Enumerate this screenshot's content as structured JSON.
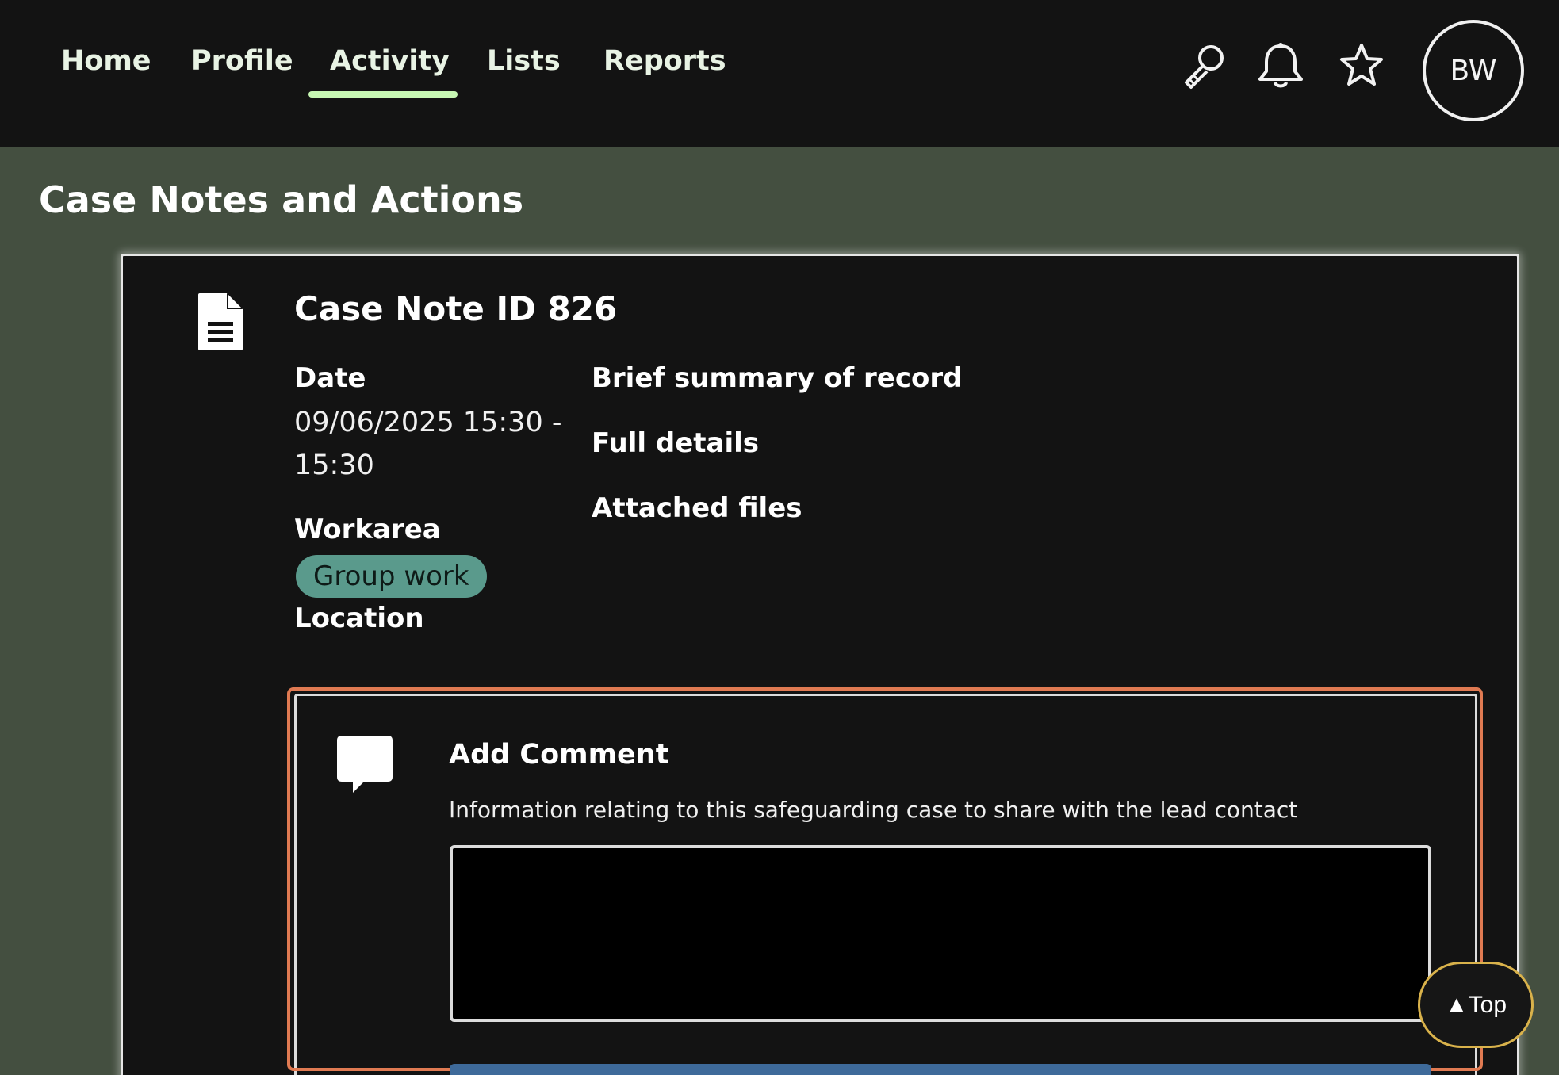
{
  "nav": {
    "items": [
      {
        "label": "Home"
      },
      {
        "label": "Profile"
      },
      {
        "label": "Activity",
        "active": true
      },
      {
        "label": "Lists"
      },
      {
        "label": "Reports"
      }
    ],
    "icons": [
      "search-icon",
      "bell-icon",
      "star-icon"
    ],
    "avatar_initials": "BW",
    "active_color": "#c7f7b3"
  },
  "page": {
    "title": "Case Notes and Actions"
  },
  "case_note": {
    "title": "Case Note ID 826",
    "date_label": "Date",
    "date_value": "09/06/2025 15:30 - 15:30",
    "workarea_label": "Workarea",
    "workarea_tag": "Group work",
    "location_label": "Location",
    "summary_label": "Brief summary of record",
    "details_label": "Full details",
    "files_label": "Attached files",
    "tag_color": "#5a9a8c"
  },
  "comment": {
    "title": "Add Comment",
    "hint": "Information relating to this safeguarding case to share with the lead contact",
    "value": "",
    "focus_color": "#e07a52"
  },
  "back_to_top": {
    "label": "▲Top"
  },
  "colors": {
    "page_background": "#444f40",
    "topbar": "#131313",
    "card": "#131313"
  }
}
